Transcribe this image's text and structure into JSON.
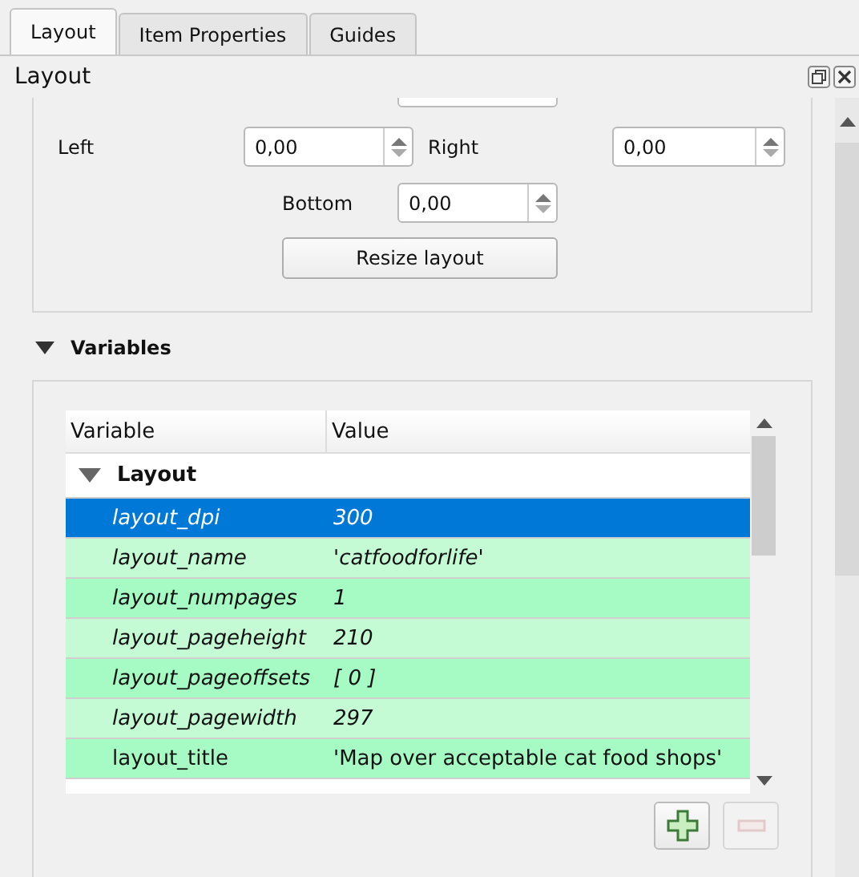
{
  "tabs": [
    {
      "label": "Layout",
      "selected": true
    },
    {
      "label": "Item Properties",
      "selected": false
    },
    {
      "label": "Guides",
      "selected": false
    }
  ],
  "panel": {
    "title": "Layout"
  },
  "margins": {
    "left": {
      "label": "Left",
      "value": "0,00"
    },
    "right": {
      "label": "Right",
      "value": "0,00"
    },
    "bottom": {
      "label": "Bottom",
      "value": "0,00"
    },
    "resize_button": "Resize layout"
  },
  "variables": {
    "title": "Variables",
    "expanded": true,
    "columns": [
      "Variable",
      "Value"
    ],
    "group": {
      "label": "Layout",
      "expanded": true
    },
    "rows": [
      {
        "name": "layout_dpi",
        "value": "300",
        "read_only": true,
        "selected": true
      },
      {
        "name": "layout_name",
        "value": "'catfoodforlife'",
        "read_only": true,
        "selected": false
      },
      {
        "name": "layout_numpages",
        "value": "1",
        "read_only": true,
        "selected": false
      },
      {
        "name": "layout_pageheight",
        "value": "210",
        "read_only": true,
        "selected": false
      },
      {
        "name": "layout_pageoffsets",
        "value": "[ 0 ]",
        "read_only": true,
        "selected": false
      },
      {
        "name": "layout_pagewidth",
        "value": "297",
        "read_only": true,
        "selected": false
      },
      {
        "name": "layout_title",
        "value": "'Map over acceptable cat food shops'",
        "read_only": false,
        "selected": false
      }
    ],
    "remove_disabled": true
  }
}
